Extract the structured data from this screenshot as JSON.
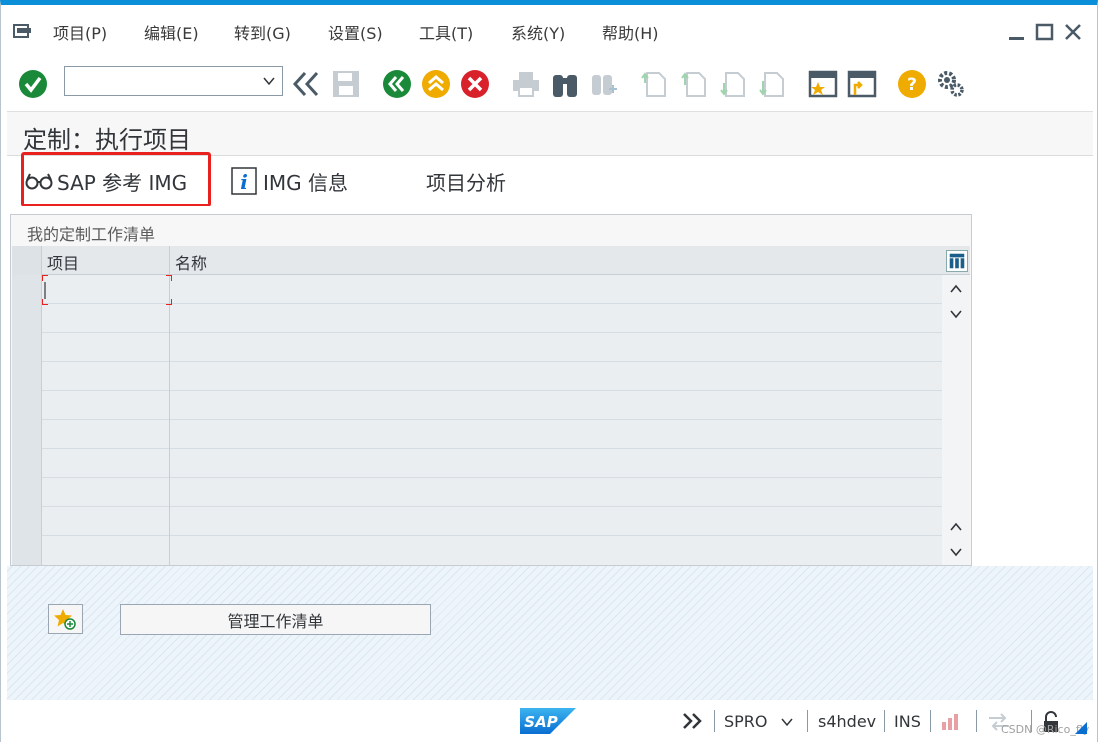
{
  "menubar": {
    "items": [
      {
        "label": "项目(P)"
      },
      {
        "label": "编辑(E)"
      },
      {
        "label": "转到(G)"
      },
      {
        "label": "设置(S)"
      },
      {
        "label": "工具(T)"
      },
      {
        "label": "系统(Y)"
      },
      {
        "label": "帮助(H)"
      }
    ],
    "icon": "menu-exit-icon"
  },
  "toolbar": {
    "command_field_value": "",
    "icons": [
      "enter-check-icon",
      "command-dropdown-icon",
      "collapse-icon",
      "save-icon",
      "back-icon",
      "exit-icon",
      "cancel-icon",
      "print-icon",
      "find-icon",
      "find-next-icon",
      "first-page-icon",
      "previous-page-icon",
      "next-page-icon",
      "last-page-icon",
      "create-shortcut-icon",
      "new-session-icon",
      "help-icon",
      "settings-gear-icon"
    ],
    "colors": {
      "green": "#1a8a3a",
      "yellow": "#f0ab00",
      "red": "#d9212c",
      "disabled": "#c5ccd2"
    }
  },
  "title": "定制：执行项目",
  "app_toolbar": {
    "sap_reference_img": "SAP 参考 IMG",
    "img_info": "IMG 信息",
    "project_analysis": "项目分析",
    "highlight_color": "#e8201e"
  },
  "worklist": {
    "title": "我的定制工作清单",
    "columns": [
      "项目",
      "名称"
    ],
    "rows": 10
  },
  "buttons": {
    "manage_worklist": "管理工作清单"
  },
  "statusbar": {
    "transaction": "SPRO",
    "system": "s4hdev",
    "mode": "INS",
    "watermark": "CSDN @Rico_fly",
    "logo_text": "SAP"
  }
}
